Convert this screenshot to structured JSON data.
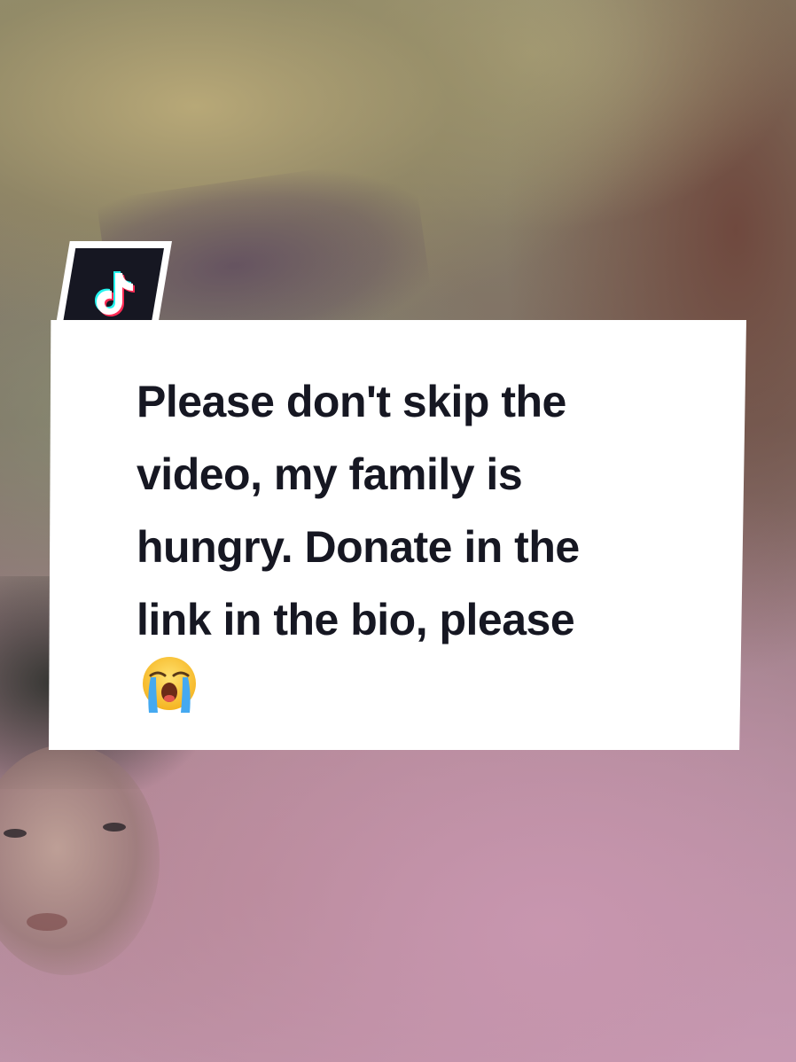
{
  "caption": {
    "lines": [
      "Please don't skip the",
      "video, my family is",
      "hungry. Donate in the",
      "link in the bio, please"
    ],
    "emoji": "😭"
  },
  "badge": {
    "icon": "tiktok-logo-icon"
  },
  "colors": {
    "caption_bg": "#ffffff",
    "caption_text": "#161722",
    "badge_bg": "#161722"
  }
}
